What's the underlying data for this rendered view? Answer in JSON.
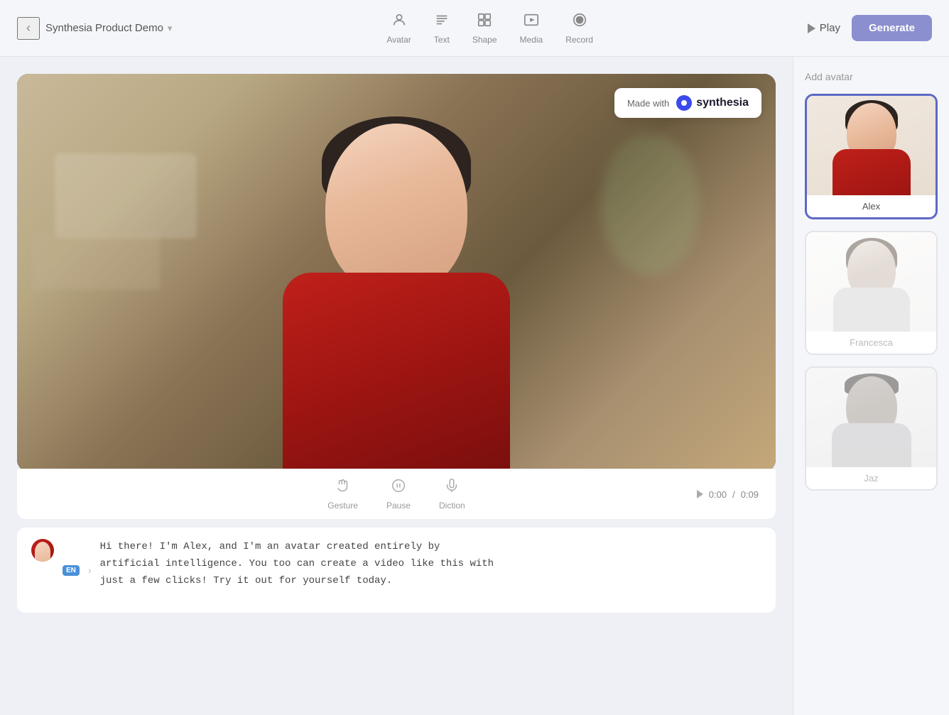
{
  "topbar": {
    "back_label": "‹",
    "project_title": "Synthesia Product Demo",
    "chevron": "▾",
    "tools": [
      {
        "id": "avatar",
        "label": "Avatar",
        "icon": "👤"
      },
      {
        "id": "text",
        "label": "Text",
        "icon": "T"
      },
      {
        "id": "shape",
        "label": "Shape",
        "icon": "⬡"
      },
      {
        "id": "media",
        "label": "Media",
        "icon": "▦"
      },
      {
        "id": "record",
        "label": "Record",
        "icon": "⏺"
      }
    ],
    "play_label": "Play",
    "generate_label": "Generate"
  },
  "video": {
    "watermark_made_with": "Made with",
    "watermark_brand": "synthesia"
  },
  "controls": {
    "gesture_label": "Gesture",
    "pause_label": "Pause",
    "diction_label": "Diction",
    "time_current": "0:00",
    "time_total": "0:09",
    "time_separator": "/"
  },
  "script": {
    "lang": "EN",
    "text": "Hi there! I'm Alex, and I'm an avatar created entirely by\nartificial intelligence. You too can create a video like this with\njust a few clicks! Try it out for yourself today."
  },
  "sidebar": {
    "title": "Add avatar",
    "avatars": [
      {
        "id": "alex",
        "name": "Alex",
        "active": true
      },
      {
        "id": "francesca",
        "name": "Francesca",
        "active": false
      },
      {
        "id": "jaz",
        "name": "Jaz",
        "active": false
      }
    ]
  },
  "colors": {
    "accent": "#5c6ac4",
    "generate_bg": "#8b8fcf",
    "lang_badge": "#4a90d9"
  }
}
